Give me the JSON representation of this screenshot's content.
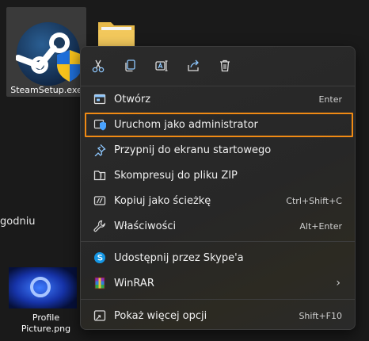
{
  "desktop": {
    "steam_label": "SteamSetup.exe",
    "side_text": "godniu",
    "picture_label_line1": "Profile",
    "picture_label_line2": "Picture.png"
  },
  "toolbar": {
    "buttons": [
      {
        "icon": "cut-icon"
      },
      {
        "icon": "copy-icon"
      },
      {
        "icon": "rename-icon"
      },
      {
        "icon": "share-icon"
      },
      {
        "icon": "delete-icon"
      }
    ]
  },
  "menu": {
    "items": [
      {
        "label": "Otwórz",
        "shortcut": "Enter",
        "icon": "open-icon"
      },
      {
        "label": "Uruchom jako administrator",
        "shortcut": "",
        "icon": "shield-icon"
      },
      {
        "label": "Przypnij do ekranu startowego",
        "shortcut": "",
        "icon": "pin-icon"
      },
      {
        "label": "Skompresuj do pliku ZIP",
        "shortcut": "",
        "icon": "zip-icon"
      },
      {
        "label": "Kopiuj jako ścieżkę",
        "shortcut": "Ctrl+Shift+C",
        "icon": "copy-path-icon"
      },
      {
        "label": "Właściwości",
        "shortcut": "Alt+Enter",
        "icon": "wrench-icon"
      },
      {
        "label": "Udostępnij przez Skype'a",
        "shortcut": "",
        "icon": "skype-icon"
      },
      {
        "label": "WinRAR",
        "shortcut": "",
        "icon": "winrar-icon"
      },
      {
        "label": "Pokaż więcej opcji",
        "shortcut": "Shift+F10",
        "icon": "more-options-icon"
      }
    ]
  },
  "colors": {
    "highlight_border": "#f08a14",
    "accent_blue": "#4aa3ff"
  }
}
